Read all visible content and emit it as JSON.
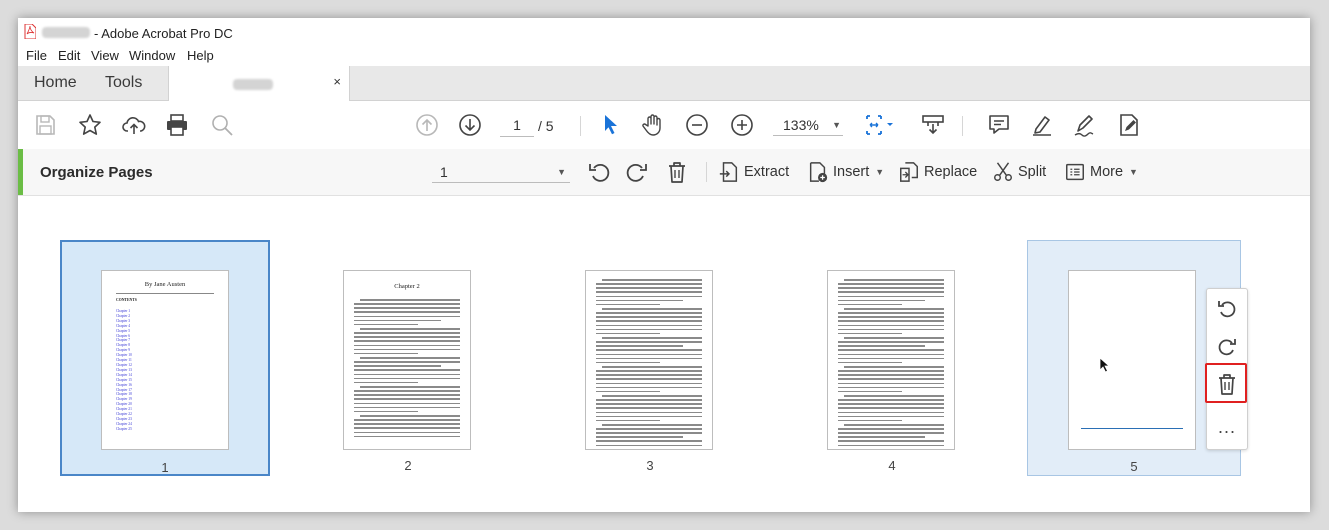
{
  "window": {
    "title": "- Adobe Acrobat Pro DC"
  },
  "menu": [
    "File",
    "Edit",
    "View",
    "Window",
    "Help"
  ],
  "tabs": {
    "home": "Home",
    "tools": "Tools",
    "close_glyph": "×"
  },
  "toolbar": {
    "current_page": "1",
    "total_pages": "/ 5",
    "zoom": "133%",
    "icons": [
      "save-icon",
      "bookmark-star-icon",
      "upload-cloud-icon",
      "print-icon",
      "search-zoom-icon",
      "page-up-icon",
      "page-down-icon",
      "select-cursor-icon",
      "hand-icon",
      "zoom-out-icon",
      "zoom-in-icon",
      "fit-page-icon",
      "scroll-mode-icon",
      "comment-icon",
      "highlight-icon",
      "sign-icon",
      "fill-sign-icon"
    ]
  },
  "organize": {
    "title": "Organize Pages",
    "page_range": "1",
    "buttons": {
      "extract": "Extract",
      "insert": "Insert",
      "replace": "Replace",
      "split": "Split",
      "more": "More"
    }
  },
  "pages": [
    {
      "number": "1",
      "state": "selected",
      "heading": "By Jane Austen",
      "contents_label": "CONTENTS",
      "toc": [
        "Chapter 1",
        "Chapter 2",
        "Chapter 3",
        "Chapter 4",
        "Chapter 5",
        "Chapter 6",
        "Chapter 7",
        "Chapter 8",
        "Chapter 9",
        "Chapter 10",
        "Chapter 11",
        "Chapter 12",
        "Chapter 13",
        "Chapter 14",
        "Chapter 15",
        "Chapter 16",
        "Chapter 17",
        "Chapter 18",
        "Chapter 19",
        "Chapter 20",
        "Chapter 21",
        "Chapter 22",
        "Chapter 23",
        "Chapter 24",
        "Chapter 25"
      ]
    },
    {
      "number": "2",
      "state": "normal",
      "heading": "Chapter 2"
    },
    {
      "number": "3",
      "state": "normal",
      "heading": ""
    },
    {
      "number": "4",
      "state": "normal",
      "heading": ""
    },
    {
      "number": "5",
      "state": "hover",
      "heading": ""
    }
  ],
  "page_actions": {
    "icons": [
      "rotate-left-icon",
      "rotate-right-icon",
      "trash-icon"
    ],
    "more": "..."
  },
  "colors": {
    "accent_green": "#6bbd45",
    "selection_border": "#4a86c8",
    "selection_fill": "#d6e8f8",
    "highlight_red": "#e02020",
    "link_blue": "#3b3bd6"
  }
}
